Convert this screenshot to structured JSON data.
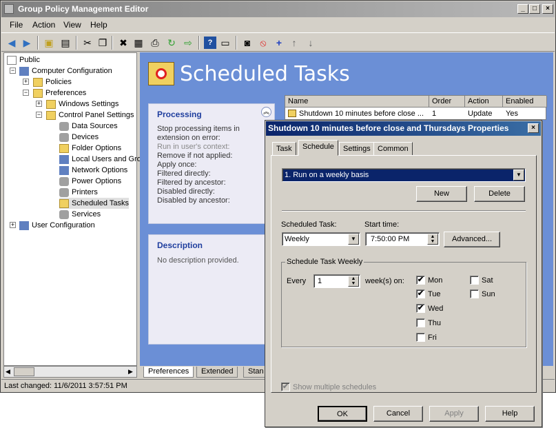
{
  "window": {
    "title": "Group Policy Management Editor"
  },
  "menu": [
    "File",
    "Action",
    "View",
    "Help"
  ],
  "tree": {
    "public": "Public",
    "computer_configuration": "Computer Configuration",
    "policies": "Policies",
    "preferences": "Preferences",
    "windows_settings": "Windows Settings",
    "control_panel_settings": "Control Panel Settings",
    "data_sources": "Data Sources",
    "devices": "Devices",
    "folder_options": "Folder Options",
    "local_users": "Local Users and Gro",
    "network_options": "Network Options",
    "power_options": "Power Options",
    "printers": "Printers",
    "scheduled_tasks": "Scheduled Tasks",
    "services": "Services",
    "user_configuration": "User Configuration"
  },
  "pane": {
    "title": "Scheduled Tasks",
    "processing_header": "Processing",
    "processing_items": [
      "Stop processing items in",
      "extension on error:",
      "Run in user's context:",
      "Remove if not applied:",
      "Apply once:",
      "Filtered directly:",
      "Filtered by ancestor:",
      "Disabled directly:",
      "Disabled by ancestor:"
    ],
    "description_header": "Description",
    "description_text": "No description provided.",
    "columns": [
      "Name",
      "Order",
      "Action",
      "Enabled"
    ],
    "row": {
      "name": "Shutdown 10 minutes before close ...",
      "order": "1",
      "action": "Update",
      "enabled": "Yes"
    }
  },
  "bottom_tabs": [
    "Preferences",
    "Extended",
    "Stan"
  ],
  "status": "Last changed: 11/6/2011 3:57:51 PM",
  "dialog": {
    "title": "Shutdown 10 minutes before close and Thursdays Properties",
    "tabs": [
      "Task",
      "Schedule",
      "Settings",
      "Common"
    ],
    "schedule_combo": "1. Run on a weekly basis",
    "new_button": "New",
    "delete_button": "Delete",
    "scheduled_task_label": "Scheduled Task:",
    "scheduled_task_value": "Weekly",
    "start_time_label": "Start time:",
    "start_time_value": "7:50:00 PM",
    "advanced_button": "Advanced...",
    "group_label": "Schedule Task Weekly",
    "every_label": "Every",
    "every_value": "1",
    "weeks_on_label": "week(s) on:",
    "days": [
      {
        "label": "Mon",
        "checked": true
      },
      {
        "label": "Tue",
        "checked": true
      },
      {
        "label": "Wed",
        "checked": true
      },
      {
        "label": "Thu",
        "checked": false
      },
      {
        "label": "Fri",
        "checked": false
      },
      {
        "label": "Sat",
        "checked": false
      },
      {
        "label": "Sun",
        "checked": false
      }
    ],
    "show_multiple": "Show multiple schedules",
    "ok": "OK",
    "cancel": "Cancel",
    "apply": "Apply",
    "help": "Help"
  }
}
